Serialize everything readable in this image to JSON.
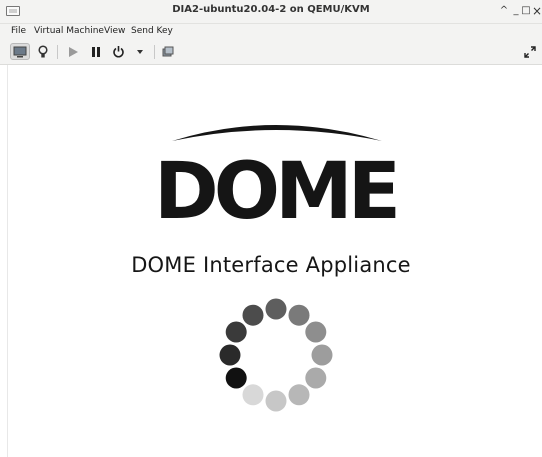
{
  "window": {
    "title": "DIA2-ubuntu20.04-2 on QEMU/KVM",
    "controls": {
      "maximize": "^",
      "minimize": "_",
      "restore": "□",
      "close": "×"
    }
  },
  "menubar": {
    "items": [
      "File",
      "Virtual Machine",
      "View",
      "Send Key"
    ]
  },
  "toolbar": {
    "buttons": [
      "console-icon",
      "lightbulb-icon",
      "run-icon",
      "pause-icon",
      "power-icon",
      "dropdown-icon",
      "snapshot-icon",
      "fullscreen-icon"
    ]
  },
  "vm_screen": {
    "logo_text": "DOME",
    "title": "DOME Interface Appliance",
    "spinner_dots": 12
  }
}
